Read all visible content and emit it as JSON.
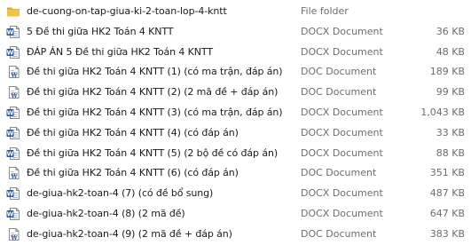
{
  "files": [
    {
      "icon": "folder-icon",
      "name": "de-cuong-on-tap-giua-ki-2-toan-lop-4-kntt",
      "type": "File folder",
      "size": ""
    },
    {
      "icon": "docx-icon",
      "name": "5 Đề thi giữa HK2 Toán 4 KNTT",
      "type": "DOCX Document",
      "size": "36 KB"
    },
    {
      "icon": "docx-icon",
      "name": "ĐÁP ÁN 5 Đề thi giữa HK2 Toán 4 KNTT",
      "type": "DOCX Document",
      "size": "48 KB"
    },
    {
      "icon": "doc-icon",
      "name": "Đề thi giữa HK2 Toán 4 KNTT (1) (có ma trận, đáp án)",
      "type": "DOC Document",
      "size": "189 KB"
    },
    {
      "icon": "doc-icon",
      "name": "Đề thi giữa HK2 Toán 4 KNTT (2) (2 mã đề + đáp án)",
      "type": "DOC Document",
      "size": "99 KB"
    },
    {
      "icon": "docx-icon",
      "name": "Đề thi giữa HK2 Toán 4 KNTT (3) (có ma trận, đáp án)",
      "type": "DOCX Document",
      "size": "1,043 KB"
    },
    {
      "icon": "docx-icon",
      "name": "Đề thi giữa HK2 Toán 4 KNTT (4) (có đáp án)",
      "type": "DOCX Document",
      "size": "33 KB"
    },
    {
      "icon": "docx-icon",
      "name": "Đề thi giữa HK2 Toán 4 KNTT (5) (2 bộ đề có đáp án)",
      "type": "DOCX Document",
      "size": "88 KB"
    },
    {
      "icon": "doc-icon",
      "name": "Đề thi giữa HK2 Toán 4 KNTT (6) (có đáp án)",
      "type": "DOC Document",
      "size": "351 KB"
    },
    {
      "icon": "docx-icon",
      "name": "de-giua-hk2-toan-4 (7) (có đề bổ sung)",
      "type": "DOCX Document",
      "size": "487 KB"
    },
    {
      "icon": "docx-icon",
      "name": "de-giua-hk2-toan-4 (8) (2 mã đề)",
      "type": "DOCX Document",
      "size": "647 KB"
    },
    {
      "icon": "doc-icon",
      "name": "de-giua-hk2-toan-4 (9) (2 mã đề + đáp án)",
      "type": "DOC Document",
      "size": "383 KB"
    }
  ],
  "colors": {
    "folder": "#f0c24b",
    "folder_dark": "#dba531",
    "word_blue": "#2b579a",
    "word_blue_light": "#41a5ee",
    "name_text": "#1a1a1a",
    "meta_text": "#6d6d6d"
  }
}
